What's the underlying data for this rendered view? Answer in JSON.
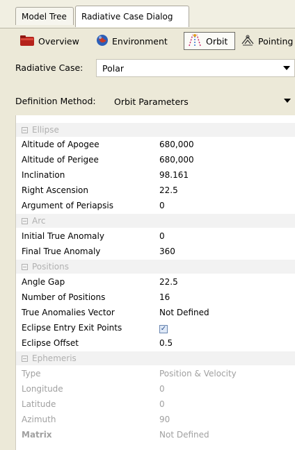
{
  "tabs": [
    {
      "label": "Model Tree"
    },
    {
      "label": "Radiative Case Dialog"
    }
  ],
  "subtabs": [
    {
      "label": "Overview",
      "icon": "folder-icon"
    },
    {
      "label": "Environment",
      "icon": "globe-icon"
    },
    {
      "label": "Orbit",
      "icon": "orbit-icon"
    },
    {
      "label": "Pointing",
      "icon": "pointing-icon"
    }
  ],
  "radiative_case": {
    "label": "Radiative Case:",
    "value": "Polar"
  },
  "definition_method": {
    "label": "Definition Method:",
    "value": "Orbit Parameters"
  },
  "ellipse": {
    "title": "Ellipse",
    "rows": [
      {
        "k": "Altitude of Apogee",
        "v": "680,000"
      },
      {
        "k": "Altitude of Perigee",
        "v": "680,000"
      },
      {
        "k": "Inclination",
        "v": "98.161"
      },
      {
        "k": "Right Ascension",
        "v": "22.5"
      },
      {
        "k": "Argument of Periapsis",
        "v": "0"
      }
    ]
  },
  "arc": {
    "title": "Arc",
    "rows": [
      {
        "k": "Initial True Anomaly",
        "v": "0"
      },
      {
        "k": "Final True Anomaly",
        "v": "360"
      }
    ]
  },
  "positions": {
    "title": "Positions",
    "rows": [
      {
        "k": "Angle Gap",
        "v": "22.5"
      },
      {
        "k": "Number of Positions",
        "v": "16"
      },
      {
        "k": "True Anomalies Vector",
        "v": "Not Defined"
      },
      {
        "k": "Eclipse Entry Exit Points",
        "v": "✓"
      },
      {
        "k": "Eclipse Offset",
        "v": "0.5"
      }
    ]
  },
  "ephemeris": {
    "title": "Ephemeris",
    "rows": [
      {
        "k": "Type",
        "v": "Position & Velocity"
      },
      {
        "k": "Longitude",
        "v": "0"
      },
      {
        "k": "Latitude",
        "v": "0"
      },
      {
        "k": "Azimuth",
        "v": "90"
      },
      {
        "k": "Matrix",
        "v": "Not Defined"
      }
    ]
  },
  "colors": {
    "active_bg": "#ffffff",
    "window_bg": "#ece9d8",
    "category_text": "#b0b0b0"
  }
}
